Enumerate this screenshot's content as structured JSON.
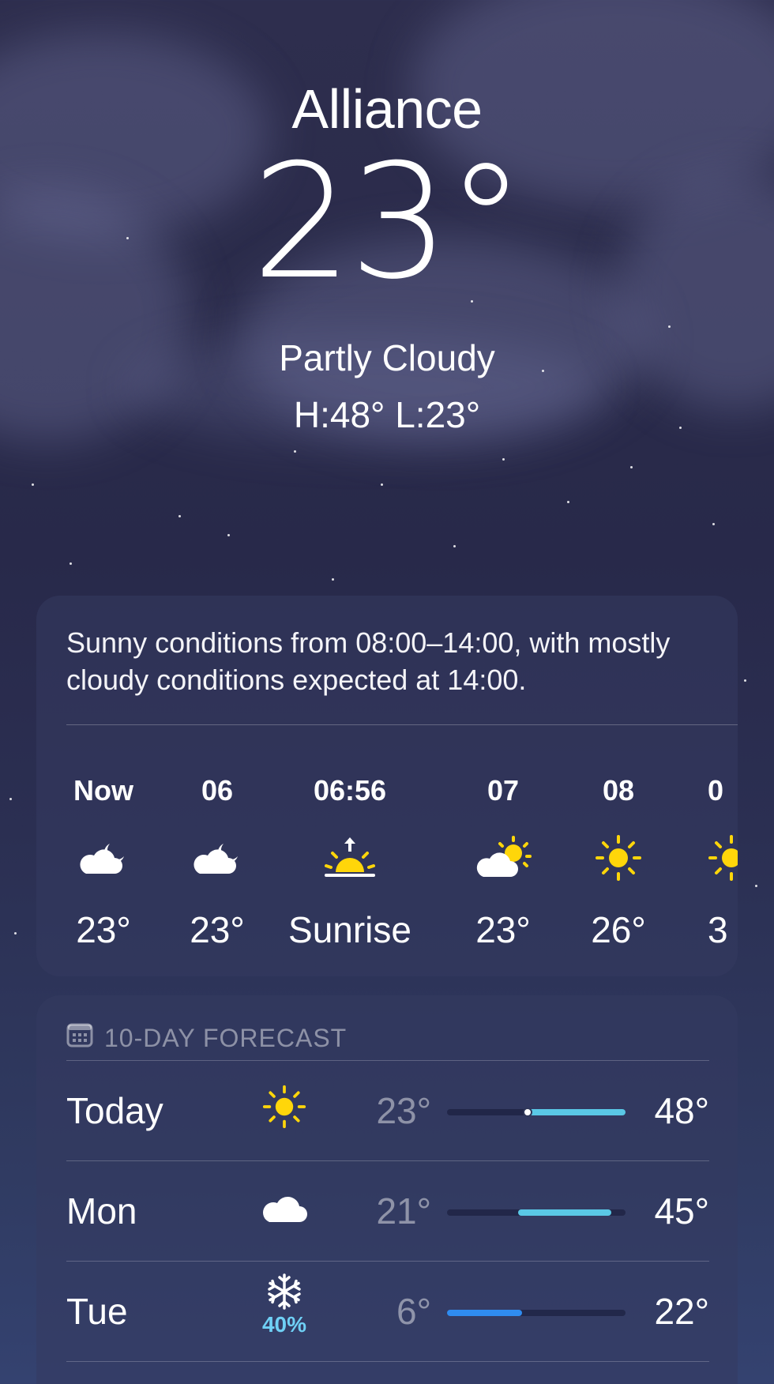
{
  "location": {
    "city": "Alliance",
    "temperature": "23°",
    "condition": "Partly Cloudy",
    "high_low": "H:48°  L:23°"
  },
  "hourly_card": {
    "summary": "Sunny conditions from 08:00–14:00, with mostly cloudy conditions expected at 14:00.",
    "hours": [
      {
        "label": "Now",
        "icon": "moon-cloud-icon",
        "value": "23°"
      },
      {
        "label": "06",
        "icon": "moon-cloud-icon",
        "value": "23°"
      },
      {
        "label": "06:56",
        "icon": "sunrise-icon",
        "value": "Sunrise"
      },
      {
        "label": "07",
        "icon": "sun-cloud-icon",
        "value": "23°"
      },
      {
        "label": "08",
        "icon": "sun-icon",
        "value": "26°"
      },
      {
        "label": "0",
        "icon": "sun-icon",
        "value": "3"
      }
    ]
  },
  "forecast_card": {
    "title": "10-DAY FORECAST",
    "header_icon": "calendar-icon",
    "days": [
      {
        "day": "Today",
        "icon": "sun-icon",
        "precip": "",
        "low": "23°",
        "high": "48°",
        "range_start": 0.45,
        "range_end": 1.0,
        "current": 0.45,
        "bar_color": "#5ac8e6"
      },
      {
        "day": "Mon",
        "icon": "cloud-icon",
        "precip": "",
        "low": "21°",
        "high": "45°",
        "range_start": 0.4,
        "range_end": 0.92,
        "bar_color": "#5ac8e6"
      },
      {
        "day": "Tue",
        "icon": "snowflake-icon",
        "precip": "40%",
        "low": "6°",
        "high": "22°",
        "range_start": 0.0,
        "range_end": 0.42,
        "bar_color": "#2f8cf0"
      }
    ]
  },
  "colors": {
    "sun": "#ffd60a",
    "precip_text": "#6fd0f5"
  }
}
